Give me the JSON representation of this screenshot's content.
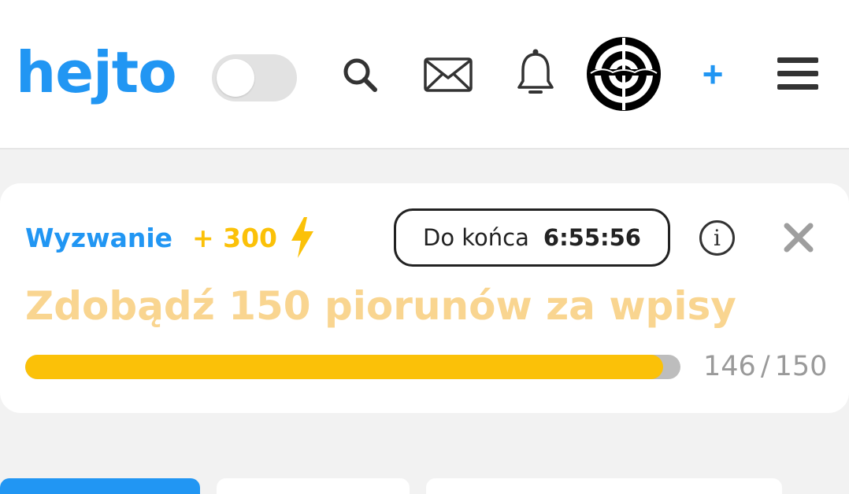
{
  "colors": {
    "brand_blue": "#2196f3",
    "accent_yellow": "#fbc108",
    "goal_text": "#f9d590",
    "progress_track": "#bdbdbd",
    "text_dark": "#333333"
  },
  "header": {
    "logo_text": "hejto",
    "theme_toggle_on": false,
    "icons": [
      "search-icon",
      "mail-icon",
      "bell-icon",
      "avatar",
      "plus-icon",
      "menu-icon"
    ],
    "add_label": "+"
  },
  "challenge": {
    "label": "Wyzwanie",
    "points": "+ 300",
    "timer_label": "Do końca",
    "timer_value": "6:55:56",
    "info_label": "i",
    "goal": "Zdobądź 150 piorunów za wpisy",
    "progress_current": "146",
    "progress_separator": "/",
    "progress_total": "150",
    "progress_fraction": 0.973
  },
  "tabs": [
    {
      "active": true
    },
    {
      "active": false
    },
    {
      "active": false
    }
  ]
}
